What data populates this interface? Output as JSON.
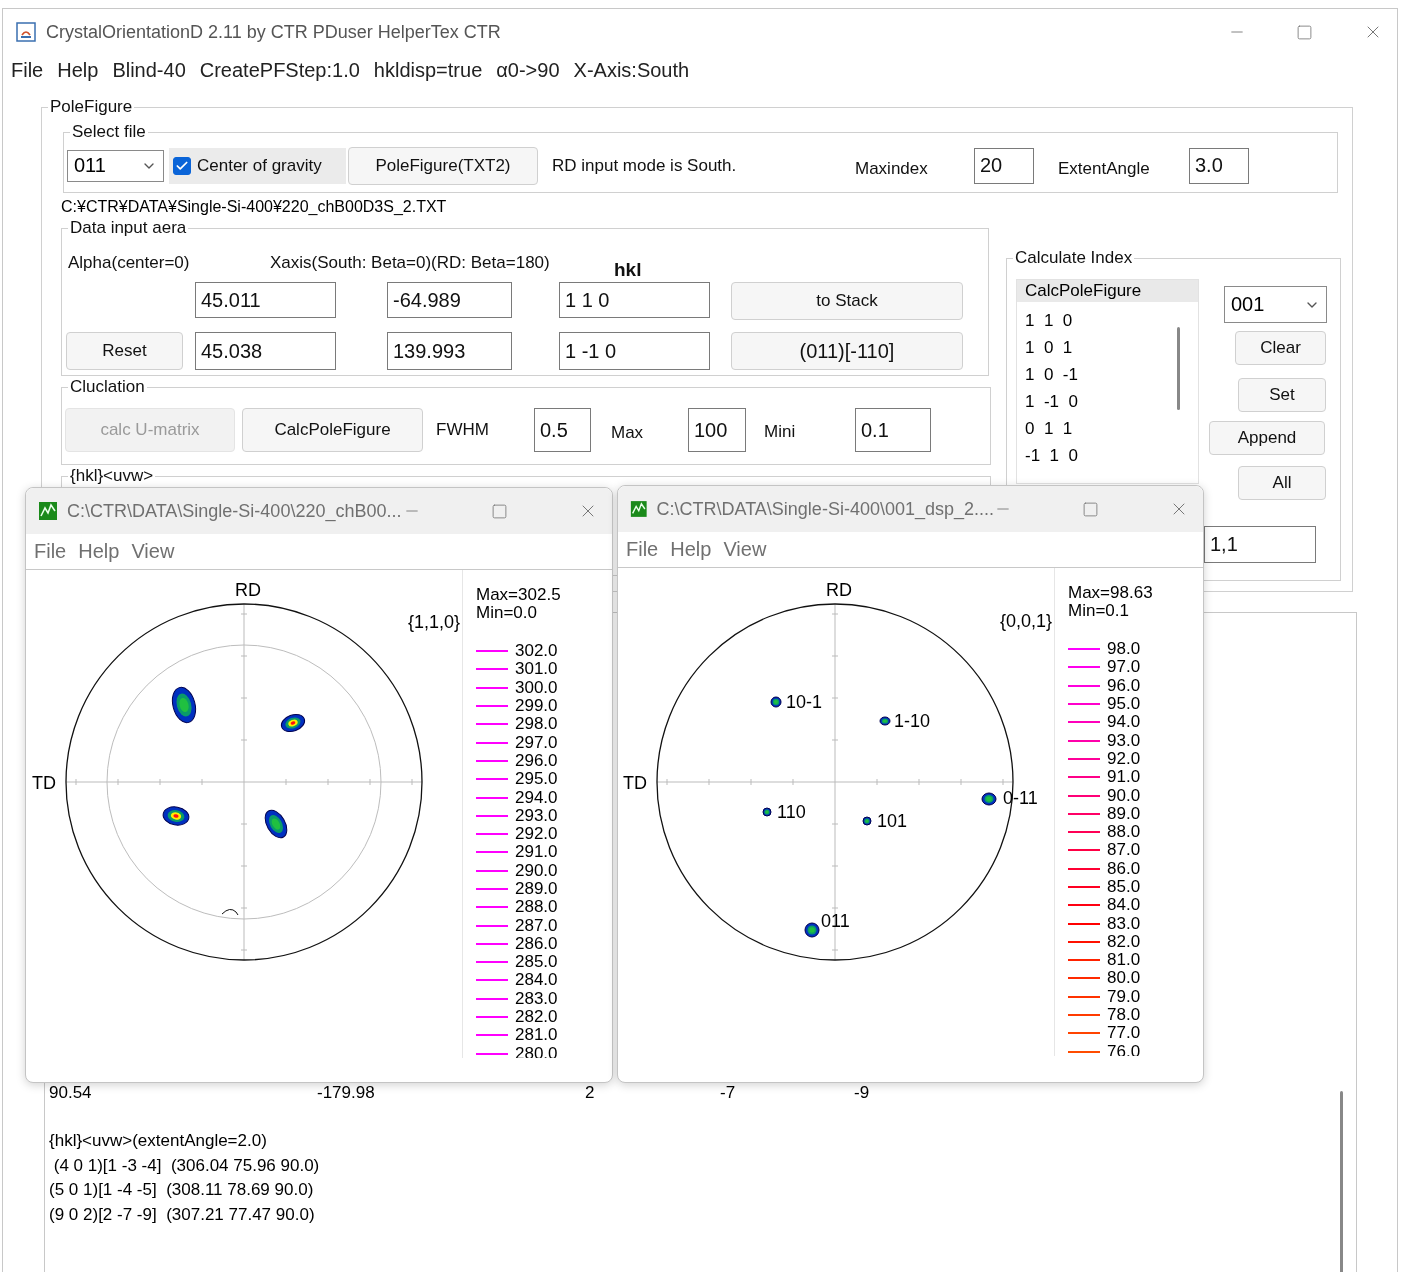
{
  "window": {
    "title": "CrystalOrientationD 2.11 by CTR PDuser HelperTex CTR"
  },
  "menu": [
    "File",
    "Help",
    "Blind-40",
    "CreatePFStep:1.0",
    "hkldisp=true",
    "α0->90",
    "X-Axis:South"
  ],
  "pole_figure_panel": {
    "title": "PoleFigure",
    "select_file": {
      "title": "Select file",
      "file_dropdown": "011",
      "center_of_gravity": {
        "label": "Center of gravity",
        "checked": true
      },
      "button": "PoleFigure(TXT2)",
      "mode_text": "RD input mode is South.",
      "maxindex": {
        "label": "Maxindex",
        "value": "20"
      },
      "extent_angle": {
        "label": "ExtentAngle",
        "value": "3.0"
      }
    },
    "file_path": "C:¥CTR¥DATA¥Single-Si-400¥220_chB00D3S_2.TXT",
    "data_input": {
      "title": "Data input aera",
      "alpha_label": "Alpha(center=0)",
      "xaxis_label": "Xaxis(South: Beta=0)(RD: Beta=180)",
      "hkl_label": "hkl",
      "reset_button": "Reset",
      "rows": [
        {
          "alpha": "45.011",
          "beta": "-64.989",
          "hkl": "1 1 0",
          "button": "to Stack"
        },
        {
          "alpha": "45.038",
          "beta": "139.993",
          "hkl": "1 -1 0",
          "button": "(011)[-110]"
        }
      ]
    },
    "calculation": {
      "title": "Cluclation",
      "umatrix_button": {
        "label": "calc U-matrix",
        "disabled": true
      },
      "calc_button": "CalcPoleFigure",
      "fwhm": {
        "label": "FWHM",
        "value": "0.5"
      },
      "max": {
        "label": "Max",
        "value": "100"
      },
      "mini": {
        "label": "Mini",
        "value": "0.1"
      }
    },
    "hkl_uvw_title": "{hkl}<uvw>",
    "calculate_index": {
      "title": "Calculate Index",
      "list_title": "CalcPoleFigure",
      "items": [
        "1  1  0",
        "1  0  1",
        "1  0  -1",
        "1  -1  0",
        "0  1  1",
        "-1  1  0"
      ],
      "dropdown": "001",
      "buttons": [
        "Clear",
        "Set",
        "Append",
        "All"
      ],
      "field_value": "1,1"
    }
  },
  "output": {
    "row": [
      "90.54",
      "-179.98",
      "2",
      "-7",
      "-9"
    ],
    "lines": [
      "{hkl}<uvw>(extentAngle=2.0)",
      " (4 0 1)[1 -3 -4]  (306.04 75.96 90.0)",
      "(5 0 1)[1 -4 -5]  (308.11 78.69 90.0)",
      "(9 0 2)[2 -7 -9]  (307.21 77.47 90.0)"
    ]
  },
  "pole_windows": [
    {
      "title": "C:\\CTR\\DATA\\Single-Si-400\\220_chB00...",
      "menu": [
        "File",
        "Help",
        "View"
      ],
      "rd": "RD",
      "td": "TD",
      "plane": "{1,1,0}",
      "max": "Max=302.5",
      "min": "Min=0.0",
      "legend": [
        {
          "value": "302.0",
          "color": "#ff00ff"
        },
        {
          "value": "301.0",
          "color": "#ff00ff"
        },
        {
          "value": "300.0",
          "color": "#ff00ff"
        },
        {
          "value": "299.0",
          "color": "#ff00ff"
        },
        {
          "value": "298.0",
          "color": "#ff00ff"
        },
        {
          "value": "297.0",
          "color": "#ff00ff"
        },
        {
          "value": "296.0",
          "color": "#ff00ff"
        },
        {
          "value": "295.0",
          "color": "#ff00ff"
        },
        {
          "value": "294.0",
          "color": "#ff00ff"
        },
        {
          "value": "293.0",
          "color": "#ff00ff"
        },
        {
          "value": "292.0",
          "color": "#ff00ff"
        },
        {
          "value": "291.0",
          "color": "#ff00ff"
        },
        {
          "value": "290.0",
          "color": "#ff00ff"
        },
        {
          "value": "289.0",
          "color": "#ff00ff"
        },
        {
          "value": "288.0",
          "color": "#ff00ff"
        },
        {
          "value": "287.0",
          "color": "#ff00ff"
        },
        {
          "value": "286.0",
          "color": "#ff00ff"
        },
        {
          "value": "285.0",
          "color": "#ff00ff"
        },
        {
          "value": "284.0",
          "color": "#ff00ff"
        },
        {
          "value": "283.0",
          "color": "#ff00ff"
        },
        {
          "value": "282.0",
          "color": "#ff00ff"
        },
        {
          "value": "281.0",
          "color": "#ff00ff"
        },
        {
          "value": "280.0",
          "color": "#ff00ff"
        }
      ]
    },
    {
      "title": "C:\\CTR\\DATA\\Single-Si-400\\001_dsp_2....",
      "menu": [
        "File",
        "Help",
        "View"
      ],
      "rd": "RD",
      "td": "TD",
      "plane": "{0,0,1}",
      "max": "Max=98.63",
      "min": "Min=0.1",
      "spot_labels": [
        "10-1",
        "1-10",
        "110",
        "101",
        "0-11",
        "011"
      ],
      "legend": [
        {
          "value": "98.0",
          "color": "#ff00ff"
        },
        {
          "value": "97.0",
          "color": "#ff00ee"
        },
        {
          "value": "96.0",
          "color": "#ff00dd"
        },
        {
          "value": "95.0",
          "color": "#ff00cc"
        },
        {
          "value": "94.0",
          "color": "#ff00bb"
        },
        {
          "value": "93.0",
          "color": "#ff00aa"
        },
        {
          "value": "92.0",
          "color": "#ff0099"
        },
        {
          "value": "91.0",
          "color": "#ff0088"
        },
        {
          "value": "90.0",
          "color": "#ff0077"
        },
        {
          "value": "89.0",
          "color": "#ff0066"
        },
        {
          "value": "88.0",
          "color": "#ff0055"
        },
        {
          "value": "87.0",
          "color": "#ff0044"
        },
        {
          "value": "86.0",
          "color": "#ff0033"
        },
        {
          "value": "85.0",
          "color": "#ff0022"
        },
        {
          "value": "84.0",
          "color": "#ff0011"
        },
        {
          "value": "83.0",
          "color": "#ff0000"
        },
        {
          "value": "82.0",
          "color": "#ff1100"
        },
        {
          "value": "81.0",
          "color": "#ff2200"
        },
        {
          "value": "80.0",
          "color": "#ff2a00"
        },
        {
          "value": "79.0",
          "color": "#ff3300"
        },
        {
          "value": "78.0",
          "color": "#ff3b00"
        },
        {
          "value": "77.0",
          "color": "#ff4400"
        },
        {
          "value": "76.0",
          "color": "#ff4c00"
        }
      ]
    }
  ]
}
